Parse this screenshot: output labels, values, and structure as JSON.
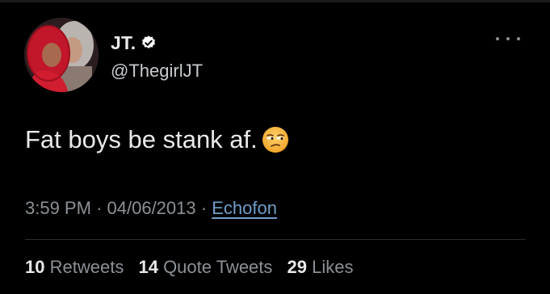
{
  "user": {
    "display_name": "JT.",
    "handle": "@ThegirlJT",
    "verified": true
  },
  "tweet": {
    "text": "Fat boys be stank af.",
    "emoji": "unamused-face-icon"
  },
  "meta": {
    "time": "3:59 PM",
    "separator": "·",
    "date": "04/06/2013",
    "source": "Echofon"
  },
  "stats": {
    "retweets_count": "10",
    "retweets_label": "Retweets",
    "quotes_count": "14",
    "quotes_label": "Quote Tweets",
    "likes_count": "29",
    "likes_label": "Likes"
  },
  "colors": {
    "background": "#000000",
    "text_primary": "#e7e9ea",
    "text_secondary": "#8b9196",
    "link": "#6f9ec9",
    "verified_badge": "#ffffff"
  }
}
